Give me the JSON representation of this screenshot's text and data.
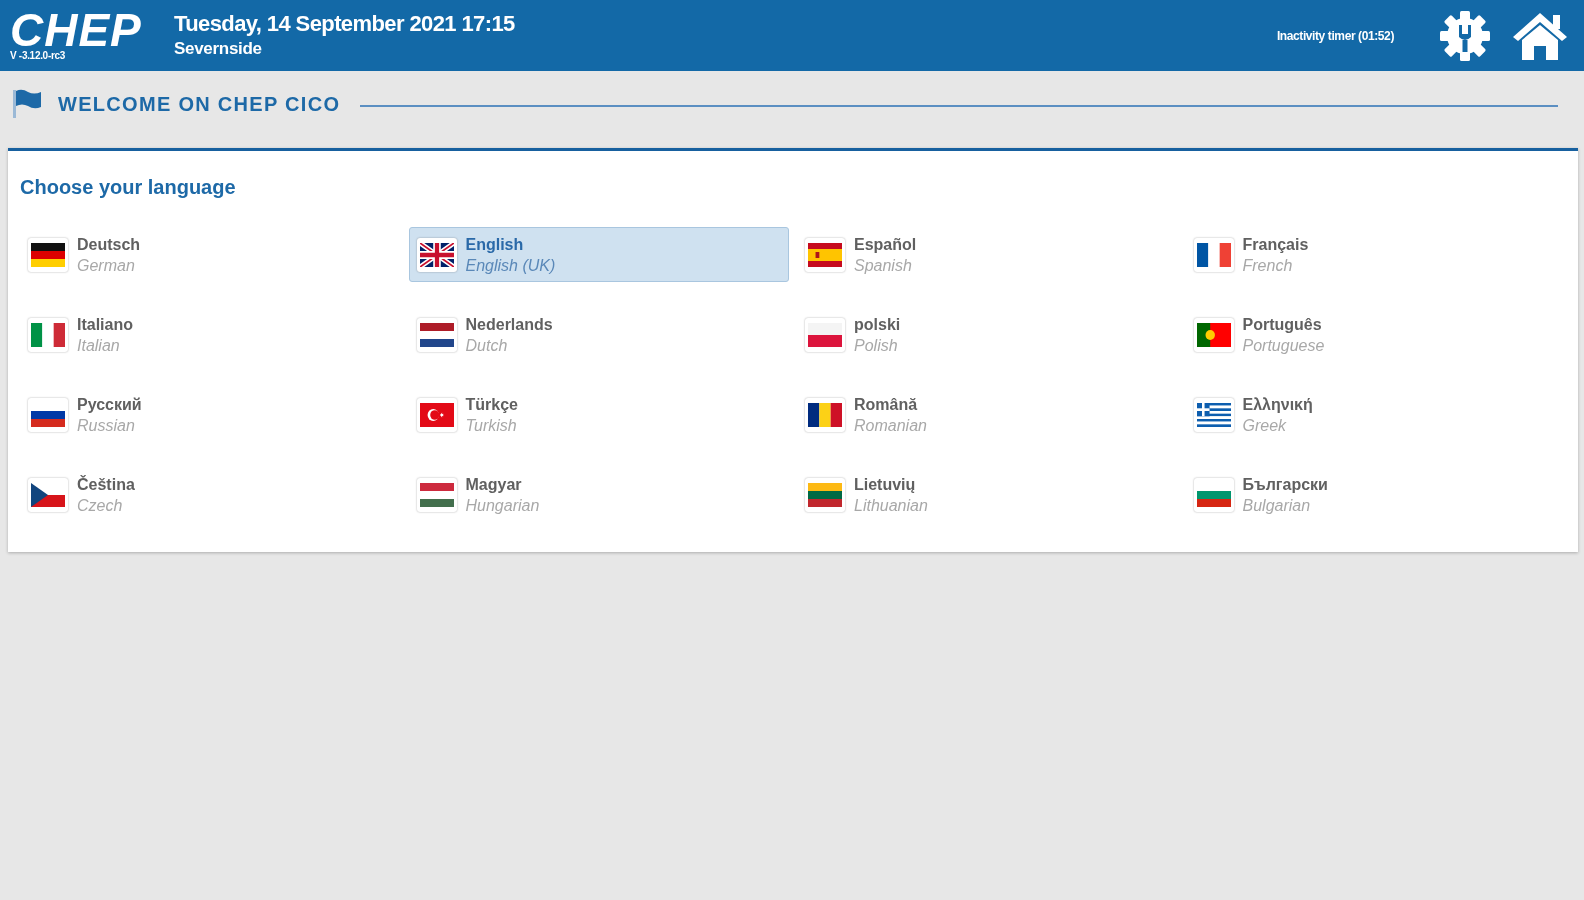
{
  "header": {
    "logo": "CHEP",
    "version": "V -3.12.0-rc3",
    "datetime": "Tuesday, 14 September 2021 17:15",
    "site": "Severnside",
    "inactivity_timer": "Inactivity timer (01:52)"
  },
  "section": {
    "title": "WELCOME ON CHEP CICO"
  },
  "language_panel": {
    "title": "Choose your language",
    "languages": [
      {
        "native": "Deutsch",
        "english": "German",
        "kind": "de",
        "selected": false
      },
      {
        "native": "English",
        "english": "English (UK)",
        "kind": "gb",
        "selected": true
      },
      {
        "native": "Español",
        "english": "Spanish",
        "kind": "es",
        "selected": false
      },
      {
        "native": "Français",
        "english": "French",
        "kind": "fr",
        "selected": false
      },
      {
        "native": "Italiano",
        "english": "Italian",
        "kind": "it",
        "selected": false
      },
      {
        "native": "Nederlands",
        "english": "Dutch",
        "kind": "nl",
        "selected": false
      },
      {
        "native": "polski",
        "english": "Polish",
        "kind": "pl",
        "selected": false
      },
      {
        "native": "Português",
        "english": "Portuguese",
        "kind": "pt",
        "selected": false
      },
      {
        "native": "Русский",
        "english": "Russian",
        "kind": "ru",
        "selected": false
      },
      {
        "native": "Türkçe",
        "english": "Turkish",
        "kind": "tr",
        "selected": false
      },
      {
        "native": "Română",
        "english": "Romanian",
        "kind": "ro",
        "selected": false
      },
      {
        "native": "Ελληνική",
        "english": "Greek",
        "kind": "gr",
        "selected": false
      },
      {
        "native": "Čeština",
        "english": "Czech",
        "kind": "cz",
        "selected": false
      },
      {
        "native": "Magyar",
        "english": "Hungarian",
        "kind": "hu",
        "selected": false
      },
      {
        "native": "Lietuvių",
        "english": "Lithuanian",
        "kind": "lt",
        "selected": false
      },
      {
        "native": "Български",
        "english": "Bulgarian",
        "kind": "bg",
        "selected": false
      }
    ]
  }
}
